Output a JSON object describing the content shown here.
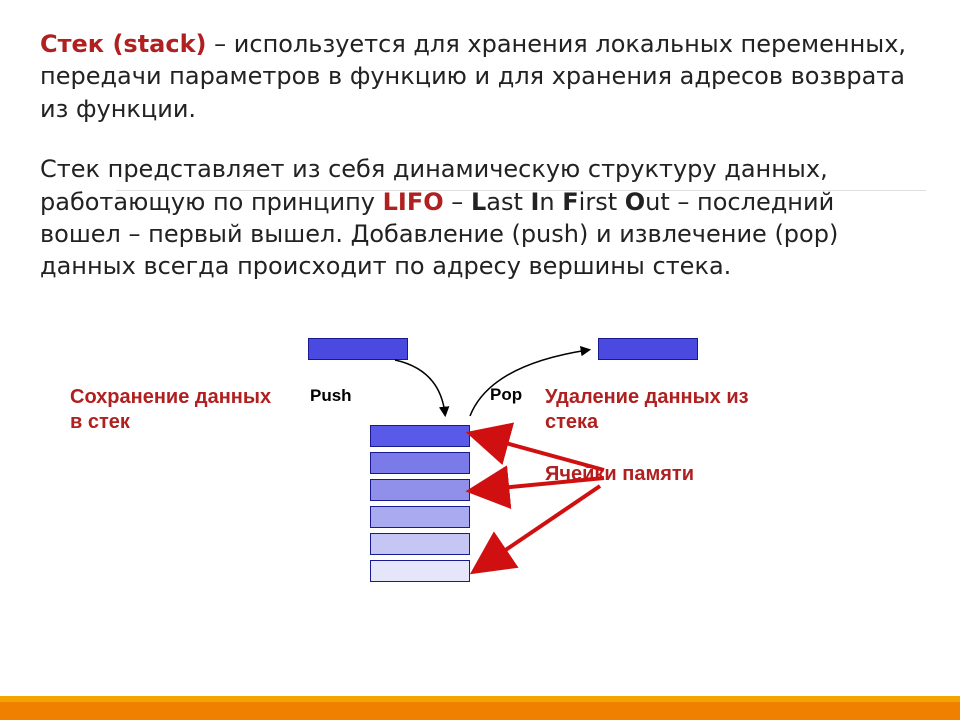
{
  "text": {
    "title_term": "Стек (stack)",
    "def_rest": " – используется для хранения локальных переменных, передачи параметров в функцию и для хранения адресов возврата из функции.",
    "para2_a": "Стек представляет из себя динамическую структуру данных, работающую по принципу ",
    "lifo": "LIFO",
    "dash": " – ",
    "L": "L",
    "ast": "ast ",
    "I": "I",
    "n": "n ",
    "F": "F",
    "irst": "irst ",
    "O": "O",
    "ut": "ut",
    "para2_b": " – последний вошел – первый вышел. Добавление (push) и извлечение (pop) данных всегда происходит по адресу вершины стека."
  },
  "diagram": {
    "push": "Push",
    "pop": "Pop",
    "save": "Сохранение данных в стек",
    "remove": "Удаление данных из стека",
    "cells": "Ячейки памяти"
  },
  "colors": {
    "accent_red": "#b02020",
    "block_border": "#1a1a90",
    "footer_orange": "#f08000",
    "footer_gold": "#f5a300"
  }
}
